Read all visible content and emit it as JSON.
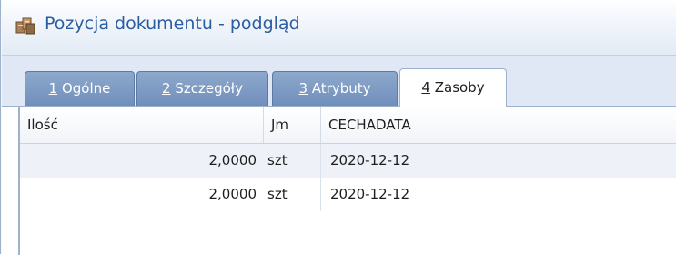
{
  "window": {
    "title": "Pozycja dokumentu - podgląd",
    "icon": "document-items-icon"
  },
  "tabs": [
    {
      "accel": "1",
      "rest": " Ogólne",
      "active": false
    },
    {
      "accel": "2",
      "rest": " Szczegóły",
      "active": false
    },
    {
      "accel": "3",
      "rest": " Atrybuty",
      "active": false
    },
    {
      "accel": "4",
      "rest": " Zasoby",
      "active": true
    }
  ],
  "grid": {
    "columns": [
      "Ilość",
      "Jm",
      "CECHADATA"
    ],
    "rows": [
      {
        "ilosc": "2,0000",
        "jm": "szt",
        "cechadata": "2020-12-12"
      },
      {
        "ilosc": "2,0000",
        "jm": "szt",
        "cechadata": "2020-12-12"
      }
    ]
  },
  "colors": {
    "title_text": "#2a5d9f",
    "tab_inactive": "#7897c2",
    "row_alt": "#eef2f8"
  }
}
